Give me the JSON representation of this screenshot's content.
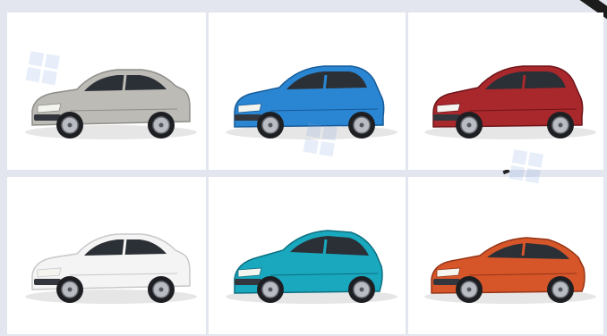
{
  "gallery": {
    "cards": [
      {
        "icon": "silver-sedan-icon",
        "color": "#bdbbb6",
        "shade": "#8f8d88",
        "type": "sedan"
      },
      {
        "icon": "blue-hatchback-icon",
        "color": "#2a86d3",
        "shade": "#165a98",
        "type": "hatch"
      },
      {
        "icon": "red-hatchback-icon",
        "color": "#a8282c",
        "shade": "#6e1418",
        "type": "hatch"
      },
      {
        "icon": "white-sedan-icon",
        "color": "#f4f4f4",
        "shade": "#c8c8cc",
        "type": "sedan"
      },
      {
        "icon": "teal-hatchback-icon",
        "color": "#1aa8bf",
        "shade": "#0d6f80",
        "type": "liftback"
      },
      {
        "icon": "orange-coupe-icon",
        "color": "#d6562a",
        "shade": "#953415",
        "type": "coupe"
      }
    ]
  }
}
